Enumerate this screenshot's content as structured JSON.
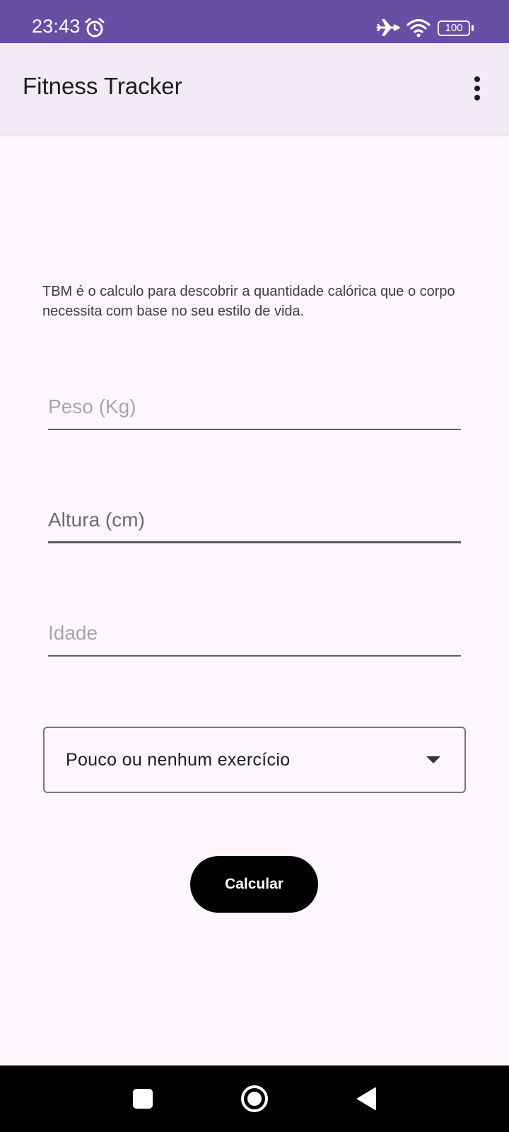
{
  "status_bar": {
    "time": "23:43",
    "battery": "100",
    "icons": [
      "alarm-icon",
      "airplane-mode-icon",
      "wifi-icon",
      "battery-icon"
    ]
  },
  "app_bar": {
    "title": "Fitness Tracker",
    "menu_icon": "more-vert-icon"
  },
  "form": {
    "description": "TBM é o calculo para descobrir a quantidade calórica que o corpo necessita com base no seu estilo de vida.",
    "weight": {
      "placeholder": "Peso (Kg)",
      "value": ""
    },
    "height": {
      "placeholder": "Altura (cm)",
      "value": ""
    },
    "age": {
      "placeholder": "Idade",
      "value": ""
    },
    "activity_select": {
      "selected": "Pouco ou nenhum exercício",
      "icon": "arrow-drop-down-icon"
    },
    "calculate_label": "Calcular"
  },
  "nav_bar": {
    "icons": [
      "recents-square-icon",
      "home-circle-icon",
      "back-triangle-icon"
    ]
  },
  "colors": {
    "status_bar": "#6750a4",
    "app_bar": "#f0ebf4",
    "background": "#fdf7fd",
    "button": "#000000",
    "nav_bar": "#000000"
  }
}
